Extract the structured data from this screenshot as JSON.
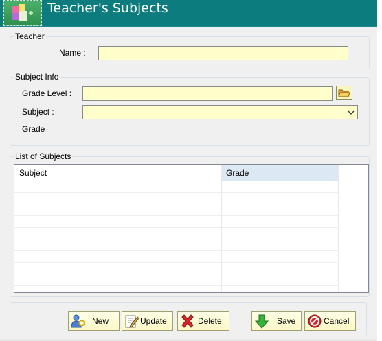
{
  "window": {
    "title": "Teacher's Subjects",
    "title_bar_color": "#0c7c7e",
    "field_color": "#ffffcc"
  },
  "teacher_group": {
    "legend": "Teacher",
    "name_label": "Name :",
    "name_value": ""
  },
  "subject_info_group": {
    "legend": "Subject Info",
    "grade_level_label": "Grade Level :",
    "grade_level_value": "",
    "subject_label": "Subject :",
    "subject_value": "",
    "grade_label": "Grade"
  },
  "list_group": {
    "legend": "List of Subjects",
    "columns": [
      "Subject",
      "Grade"
    ],
    "rows": []
  },
  "buttons": {
    "new": "New",
    "update": "Update",
    "delete": "Delete",
    "save": "Save",
    "cancel": "Cancel"
  },
  "icons": {
    "app": "notebook-icon",
    "folder": "open-folder-icon",
    "dropdown": "chevron-down-icon",
    "new": "new-user-icon",
    "update": "edit-pencil-icon",
    "delete": "red-x-icon",
    "save": "green-down-arrow-icon",
    "cancel": "no-entry-icon"
  }
}
